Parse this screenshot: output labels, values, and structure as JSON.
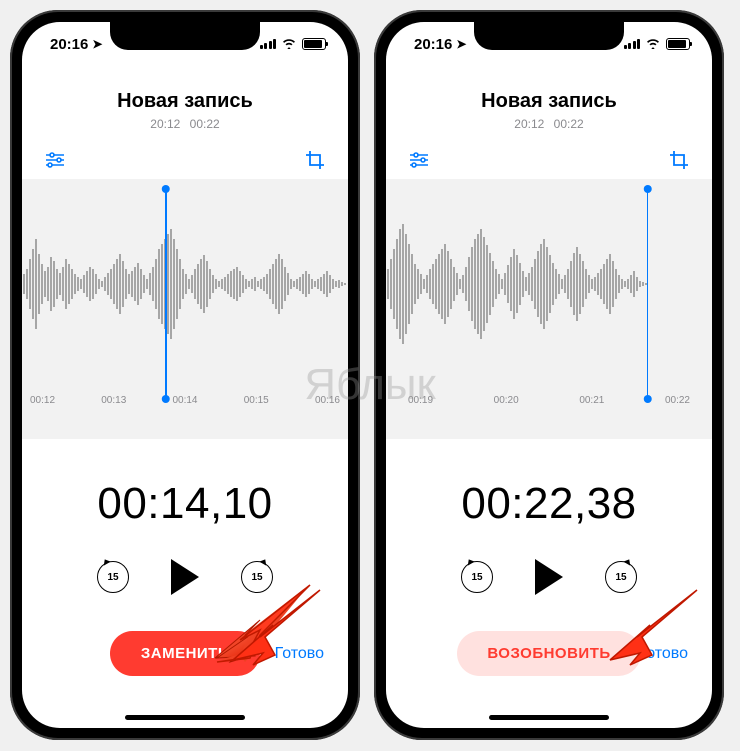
{
  "watermark": "Яблык",
  "status": {
    "time": "20:16"
  },
  "left": {
    "title": "Новая запись",
    "meta_time": "20:12",
    "meta_dur": "00:22",
    "ruler": [
      "00:12",
      "00:13",
      "00:14",
      "00:15",
      "00:16"
    ],
    "playhead_pct": 44,
    "time": "00:14,10",
    "skip_label": "15",
    "action": "ЗАМЕНИТЬ",
    "done": "Готово"
  },
  "right": {
    "title": "Новая запись",
    "meta_time": "20:12",
    "meta_dur": "00:22",
    "ruler": [
      "00:19",
      "00:20",
      "00:21",
      "00:22"
    ],
    "playhead_pct": 80,
    "time": "00:22,38",
    "skip_label": "15",
    "action": "ВОЗОБНОВИТЬ",
    "done": "Готово"
  }
}
